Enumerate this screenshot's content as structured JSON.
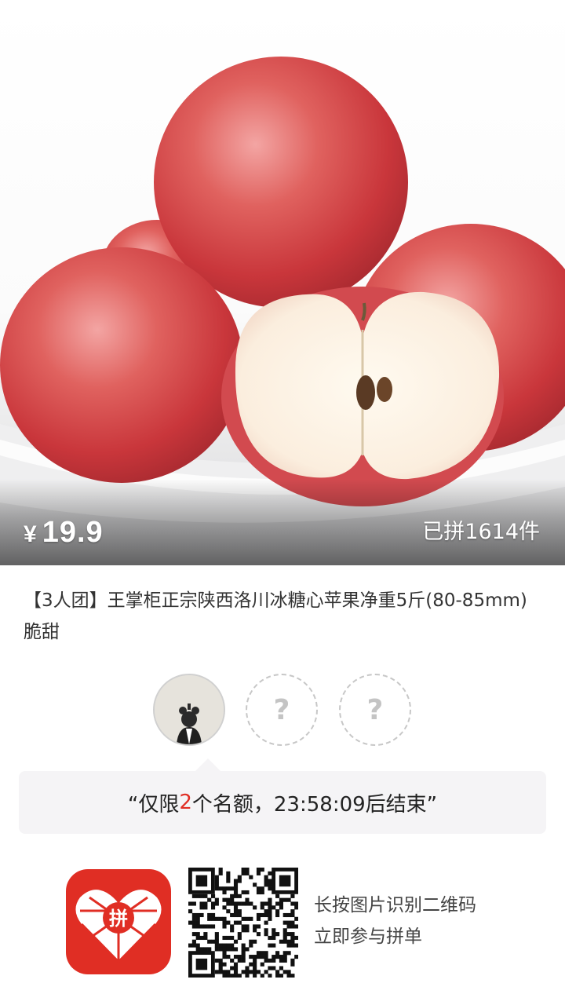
{
  "product": {
    "currency": "¥",
    "price": "19.9",
    "sold": "已拼1614件",
    "title": "【3人团】王掌柜正宗陕西洛川冰糖心苹果净重5斤(80-85mm)脆甜"
  },
  "group": {
    "empty_slot_symbol": "?",
    "notice_prefix": "“仅限",
    "notice_count": "2",
    "notice_suffix": "个名额，23:58:09后结束”"
  },
  "footer": {
    "app_logo_text": "拼",
    "hint_line1": "长按图片识别二维码",
    "hint_line2": "立即参与拼单"
  },
  "colors": {
    "brand_red": "#e02e24",
    "notice_bg": "#f5f4f6"
  },
  "icons": {
    "app_logo": "pinduoduo-logo-icon",
    "qr": "qr-code-icon",
    "avatar": "user-avatar-icon"
  }
}
